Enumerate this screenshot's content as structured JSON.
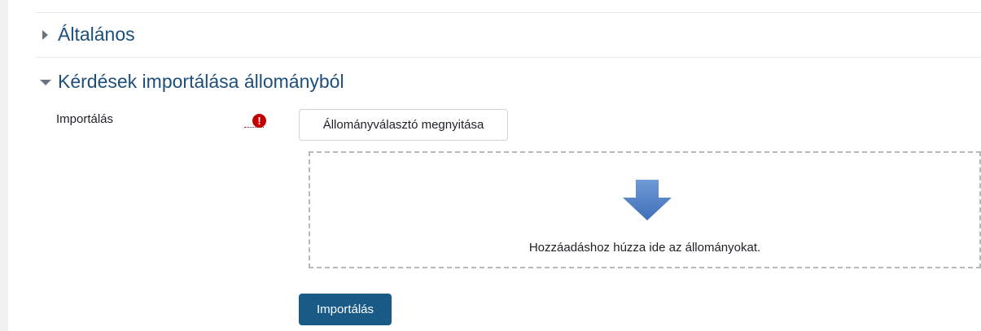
{
  "sections": {
    "general_title": "Általános",
    "import_title": "Kérdések importálása állományból"
  },
  "form": {
    "field_label": "Importálás",
    "required_icon": "exclamation-circle-icon",
    "choose_button_label": "Állományválasztó megnyitása",
    "dropzone_text": "Hozzáadáshoz húzza ide az állományokat.",
    "submit_label": "Importálás"
  },
  "colors": {
    "section_title": "#1d4f7a",
    "primary_button": "#1a5a86",
    "required_icon": "#c20000",
    "drop_arrow": "#4a7fc1"
  }
}
